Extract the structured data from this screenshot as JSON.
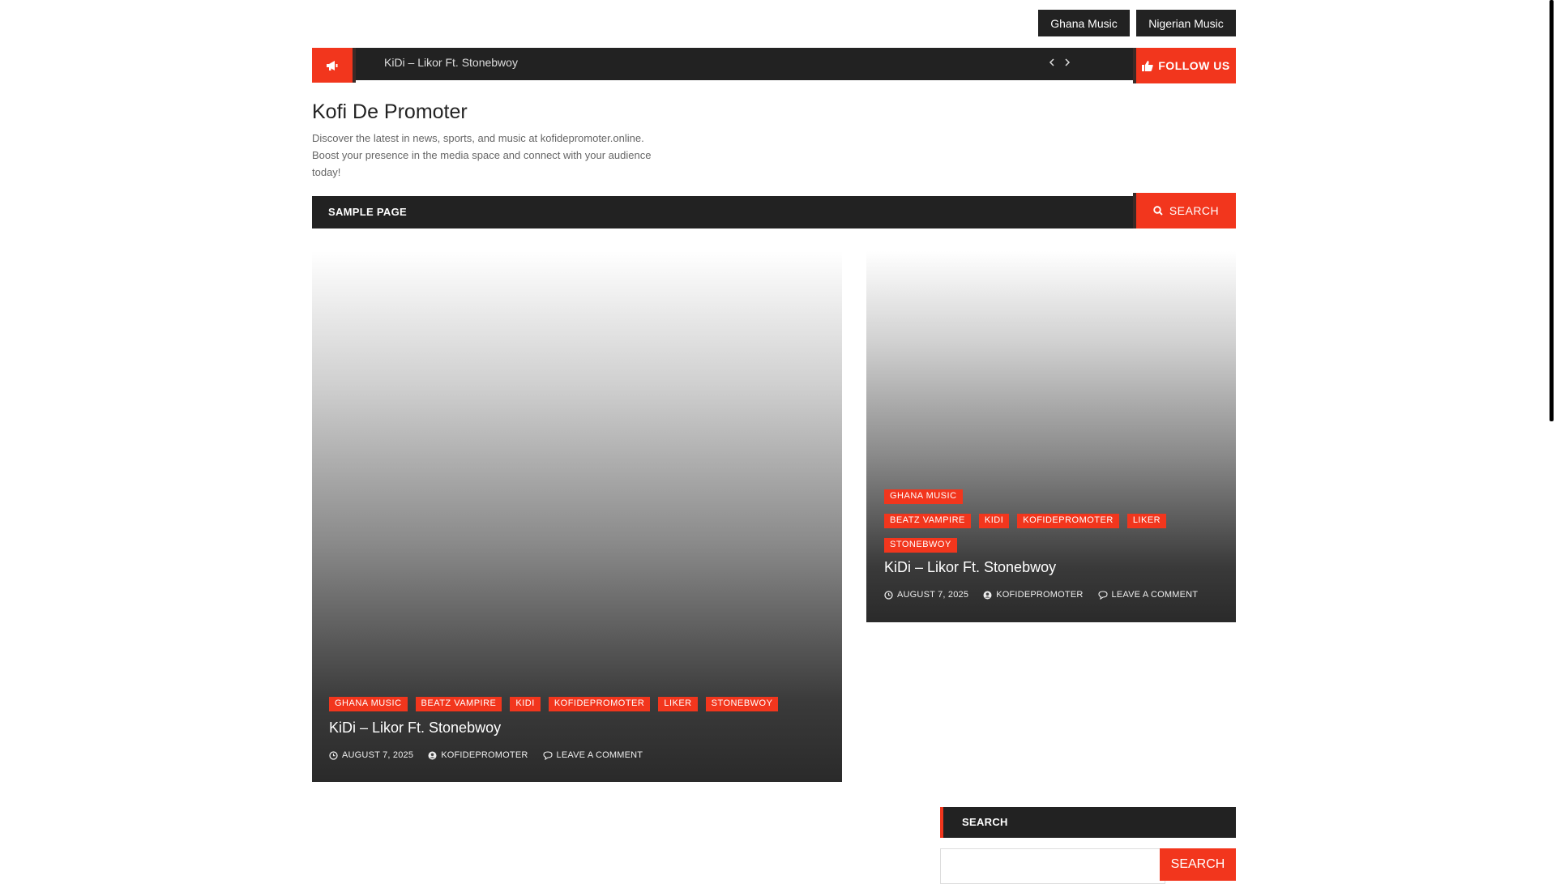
{
  "top_menu": {
    "items": [
      "Ghana Music",
      "Nigerian Music"
    ]
  },
  "ticker": {
    "headline": "KiDi – Likor Ft. Stonebwoy",
    "follow_label": "FOLLOW US"
  },
  "site": {
    "title": "Kofi De Promoter",
    "description": "Discover the latest in news, sports, and music at kofidepromoter.online. Boost your presence in the media space and connect with your audience today!"
  },
  "nav": {
    "item": "SAMPLE PAGE",
    "search_label": "SEARCH"
  },
  "posts": [
    {
      "tags": [
        "GHANA MUSIC",
        "BEATZ VAMPIRE",
        "KIDI",
        "KOFIDEPROMOTER",
        "LIKER",
        "STONEBWOY"
      ],
      "title": "KiDi – Likor Ft. Stonebwoy",
      "date": "AUGUST 7, 2025",
      "author": "KOFIDEPROMOTER",
      "comments": "LEAVE A COMMENT"
    },
    {
      "tags": [
        "GHANA MUSIC",
        "BEATZ VAMPIRE",
        "KIDI",
        "KOFIDEPROMOTER",
        "LIKER",
        "STONEBWOY"
      ],
      "title": "KiDi – Likor Ft. Stonebwoy",
      "date": "AUGUST 7, 2025",
      "author": "KOFIDEPROMOTER",
      "comments": "LEAVE A COMMENT"
    }
  ],
  "sidebar": {
    "widget_title": "SEARCH",
    "search_button": "SEARCH"
  },
  "colors": {
    "accent": "#f2361d",
    "dark": "#222222"
  }
}
